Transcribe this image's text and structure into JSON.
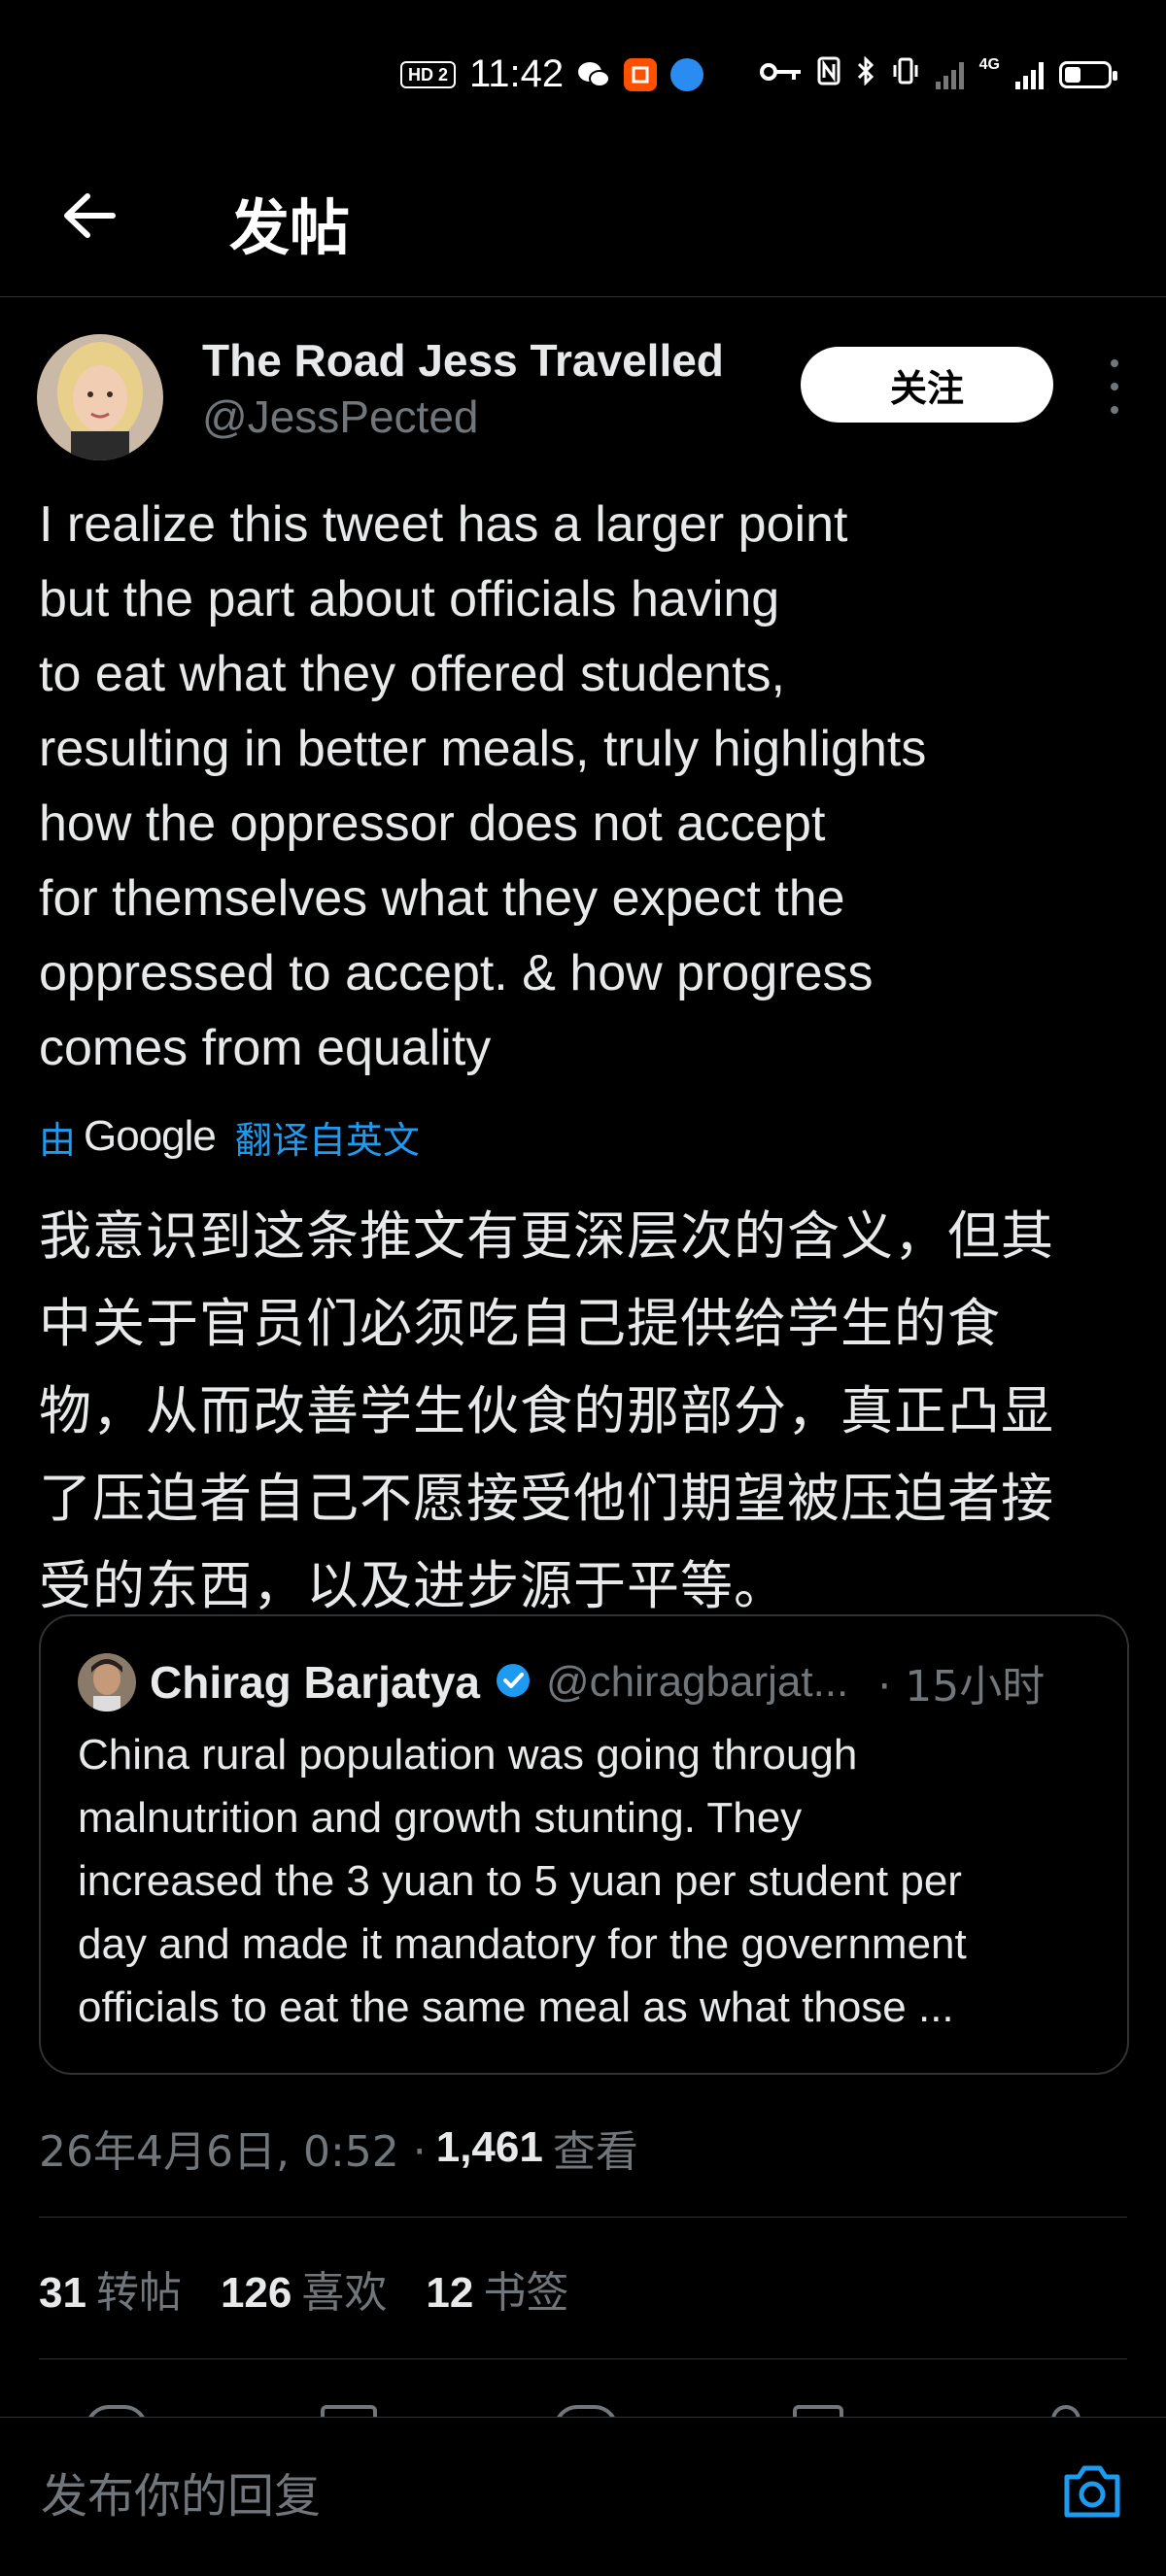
{
  "status_bar": {
    "hd_label": "HD 2",
    "time": "11:42",
    "network_label": "4G"
  },
  "header": {
    "title": "发帖"
  },
  "author": {
    "name": "The Road Jess Travelled",
    "handle": "@JessPected",
    "follow_label": "关注"
  },
  "tweet": {
    "lines": [
      "I realize this tweet has a larger point",
      "but the part about officials having",
      "to eat what they offered students,",
      "resulting in better meals, truly highlights",
      "how the oppressor does not accept",
      "for themselves what they expect the",
      "oppressed to accept. & how progress",
      "comes from equality"
    ]
  },
  "translation": {
    "by_label": "由",
    "provider": "Google",
    "link_label": "翻译自英文",
    "lines": [
      "我意识到这条推文有更深层次的含义，但其",
      "中关于官员们必须吃自己提供给学生的食",
      "物，从而改善学生伙食的那部分，真正凸显",
      "了压迫者自己不愿接受他们期望被压迫者接",
      "受的东西，以及进步源于平等。"
    ]
  },
  "quote": {
    "name": "Chirag Barjatya",
    "handle": "@chiragbarjat...",
    "time": "· 15小时",
    "lines": [
      "China rural population was going through",
      "malnutrition and growth stunting. They",
      "increased the 3 yuan to 5 yuan per student per",
      "day and made it mandatory for the government",
      "officials to eat the same meal as what those ..."
    ]
  },
  "meta": {
    "timestamp": "26年4月6日, 0:52 ·",
    "views": "1,461",
    "views_label": "查看"
  },
  "stats": {
    "reposts_count": "31",
    "reposts_label": "转帖",
    "likes_count": "126",
    "likes_label": "喜欢",
    "bookmarks_count": "12",
    "bookmarks_label": "书签"
  },
  "reply": {
    "placeholder": "发布你的回复"
  },
  "colors": {
    "background": "#000000",
    "text": "#e7e9ea",
    "secondary": "#71767b",
    "accent": "#1d9bf0",
    "border": "#2f3336"
  }
}
